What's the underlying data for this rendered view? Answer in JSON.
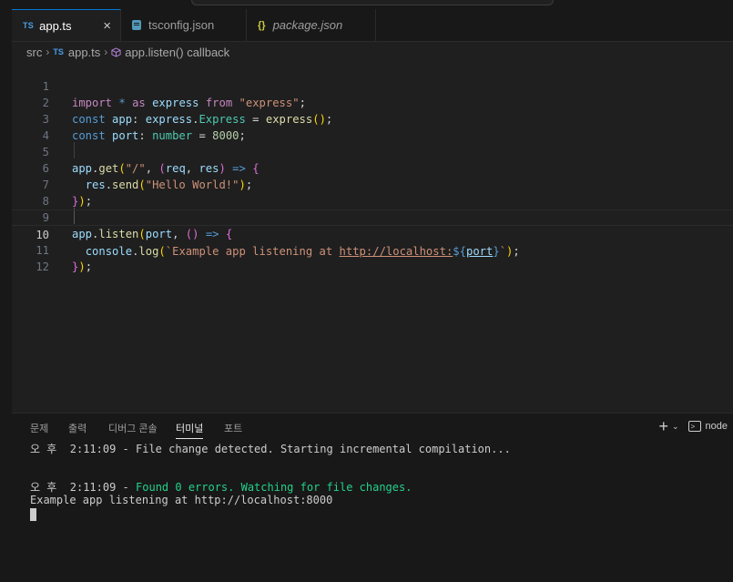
{
  "tabs": [
    {
      "badge": "TS",
      "label": "app.ts",
      "close": "×"
    },
    {
      "label": "tsconfig.json"
    },
    {
      "badge": "{}",
      "label": "package.json"
    }
  ],
  "breadcrumb": {
    "folder": "src",
    "file_badge": "TS",
    "file": "app.ts",
    "symbol": "app.listen() callback"
  },
  "line_numbers": [
    "1",
    "2",
    "3",
    "4",
    "5",
    "6",
    "7",
    "8",
    "9",
    "10",
    "11",
    "12"
  ],
  "code": {
    "l1": {
      "import": "import",
      "star": "*",
      "as": "as",
      "express": "express",
      "from": "from",
      "module": "\"express\"",
      "end": ";"
    },
    "l2": {
      "const": "const",
      "app": "app",
      "colon": ":",
      "ns": "express",
      "dot": ".",
      "type": "Express",
      "eq": "=",
      "call": "express",
      "b1o": "(",
      "b1c": ")",
      "end": ";"
    },
    "l3": {
      "const": "const",
      "port": "port",
      "colon": ":",
      "type": "number",
      "eq": "=",
      "num": "8000",
      "end": ";"
    },
    "l5": {
      "obj": "app",
      "dot": ".",
      "fn": "get",
      "b1o": "(",
      "path": "\"/\"",
      "comma": ",",
      "b2o": "(",
      "req": "req",
      "comma2": ",",
      "res": "res",
      "b2c": ")",
      "arrow": "=>",
      "b2open": "{"
    },
    "l6": {
      "obj": "res",
      "dot": ".",
      "fn": "send",
      "b3o": "(",
      "str": "\"Hello World!\"",
      "b3c": ")",
      "end": ";"
    },
    "l7": {
      "b2close": "}",
      "b1c": ")",
      "end": ";"
    },
    "l9": {
      "obj": "app",
      "dot": ".",
      "fn": "listen",
      "b1o": "(",
      "port": "port",
      "comma": ",",
      "b2o": "(",
      "b2c": ")",
      "arrow": "=>",
      "b2open": "{"
    },
    "l10": {
      "obj": "console",
      "dot": ".",
      "fn": "log",
      "b3o": "(",
      "tick": "`",
      "text": "Example app listening at ",
      "url": "http://localhost:",
      "interp_open": "${",
      "var": "port",
      "interp_close": "}",
      "tick2": "`",
      "b3c": ")",
      "end": ";"
    },
    "l11": {
      "b2close": "}",
      "b1c": ")",
      "end": ";"
    }
  },
  "panel": {
    "tabs": [
      "문제",
      "출력",
      "디버그 콘솔",
      "터미널",
      "포트"
    ],
    "active_tab": "터미널",
    "plus": "+",
    "chevron": "⌄",
    "terminal_label": "node"
  },
  "terminal": {
    "line1": "오 후  2:11:09 - File change detected. Starting incremental compilation...",
    "line2_prefix": "오 후  2:11:09 - ",
    "line2_msg": "Found 0 errors. Watching for file changes.",
    "line3": "Example app listening at http://localhost:8000"
  },
  "colors": {
    "accent": "#0078d4",
    "editor_bg": "#1f1f1f",
    "panel_bg": "#181818",
    "terminal_green": "#23d18b"
  }
}
